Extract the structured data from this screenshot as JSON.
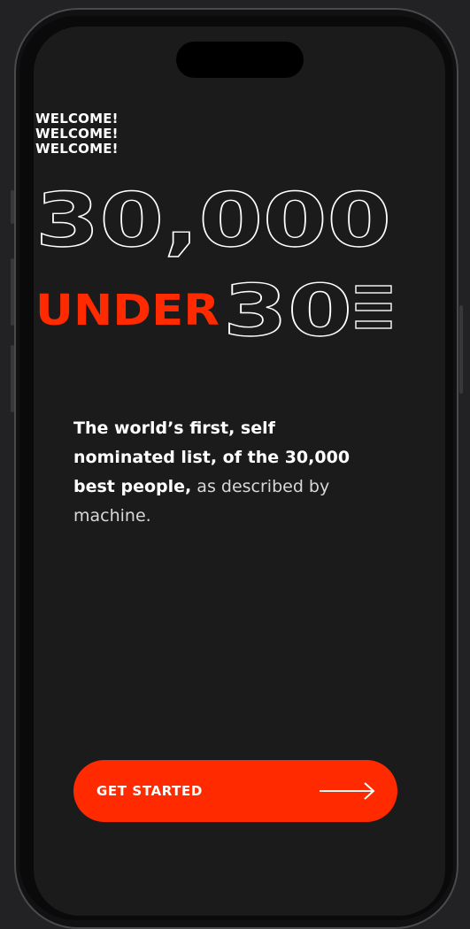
{
  "welcome": {
    "lines": [
      "WELCOME!",
      "WELCOME!",
      "WELCOME!"
    ]
  },
  "hero": {
    "number": "30,000",
    "under": "UNDER",
    "thirty": "30"
  },
  "description": {
    "bold": "The world’s first, self nominated list, of the 30,000 best people,",
    "regular": " as described by machine."
  },
  "cta": {
    "label": "GET STARTED",
    "icon": "arrow-right-icon"
  },
  "colors": {
    "accent": "#ff2a00",
    "background": "#1b1b1b",
    "text": "#ffffff"
  }
}
